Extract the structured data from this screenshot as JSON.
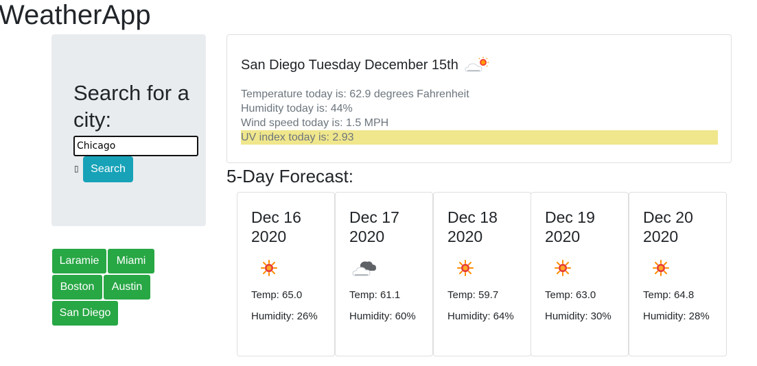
{
  "app": {
    "title": "WeatherApp"
  },
  "search": {
    "heading": "Search for a city:",
    "input_value": "Chicago",
    "checkbox_glyph": "▯",
    "button_label": "Search"
  },
  "history": [
    "Laramie",
    "Miami",
    "Boston",
    "Austin",
    "San Diego"
  ],
  "current": {
    "title": "San Diego Tuesday December 15th",
    "icon": "partly-cloudy-day-icon",
    "temperature": "Temperature today is: 62.9 degrees Fahrenheit",
    "humidity": "Humidity today is: 44%",
    "wind": "Wind speed today is: 1.5 MPH",
    "uv": "UV index today is: 2.93",
    "uv_color": "#f0e68c"
  },
  "forecast": {
    "heading": "5-Day Forecast:",
    "days": [
      {
        "date": "Dec 16 2020",
        "icon": "sun-icon",
        "temp": "Temp: 65.0",
        "humidity": "Humidity: 26%"
      },
      {
        "date": "Dec 17 2020",
        "icon": "cloud-icon",
        "temp": "Temp: 61.1",
        "humidity": "Humidity: 60%"
      },
      {
        "date": "Dec 18 2020",
        "icon": "sun-icon",
        "temp": "Temp: 59.7",
        "humidity": "Humidity: 64%"
      },
      {
        "date": "Dec 19 2020",
        "icon": "sun-icon",
        "temp": "Temp: 63.0",
        "humidity": "Humidity: 30%"
      },
      {
        "date": "Dec 20 2020",
        "icon": "sun-icon",
        "temp": "Temp: 64.8",
        "humidity": "Humidity: 28%"
      }
    ]
  },
  "colors": {
    "search_button": "#17a2b8",
    "history_button": "#28a745",
    "panel_background": "#e9ecef"
  }
}
